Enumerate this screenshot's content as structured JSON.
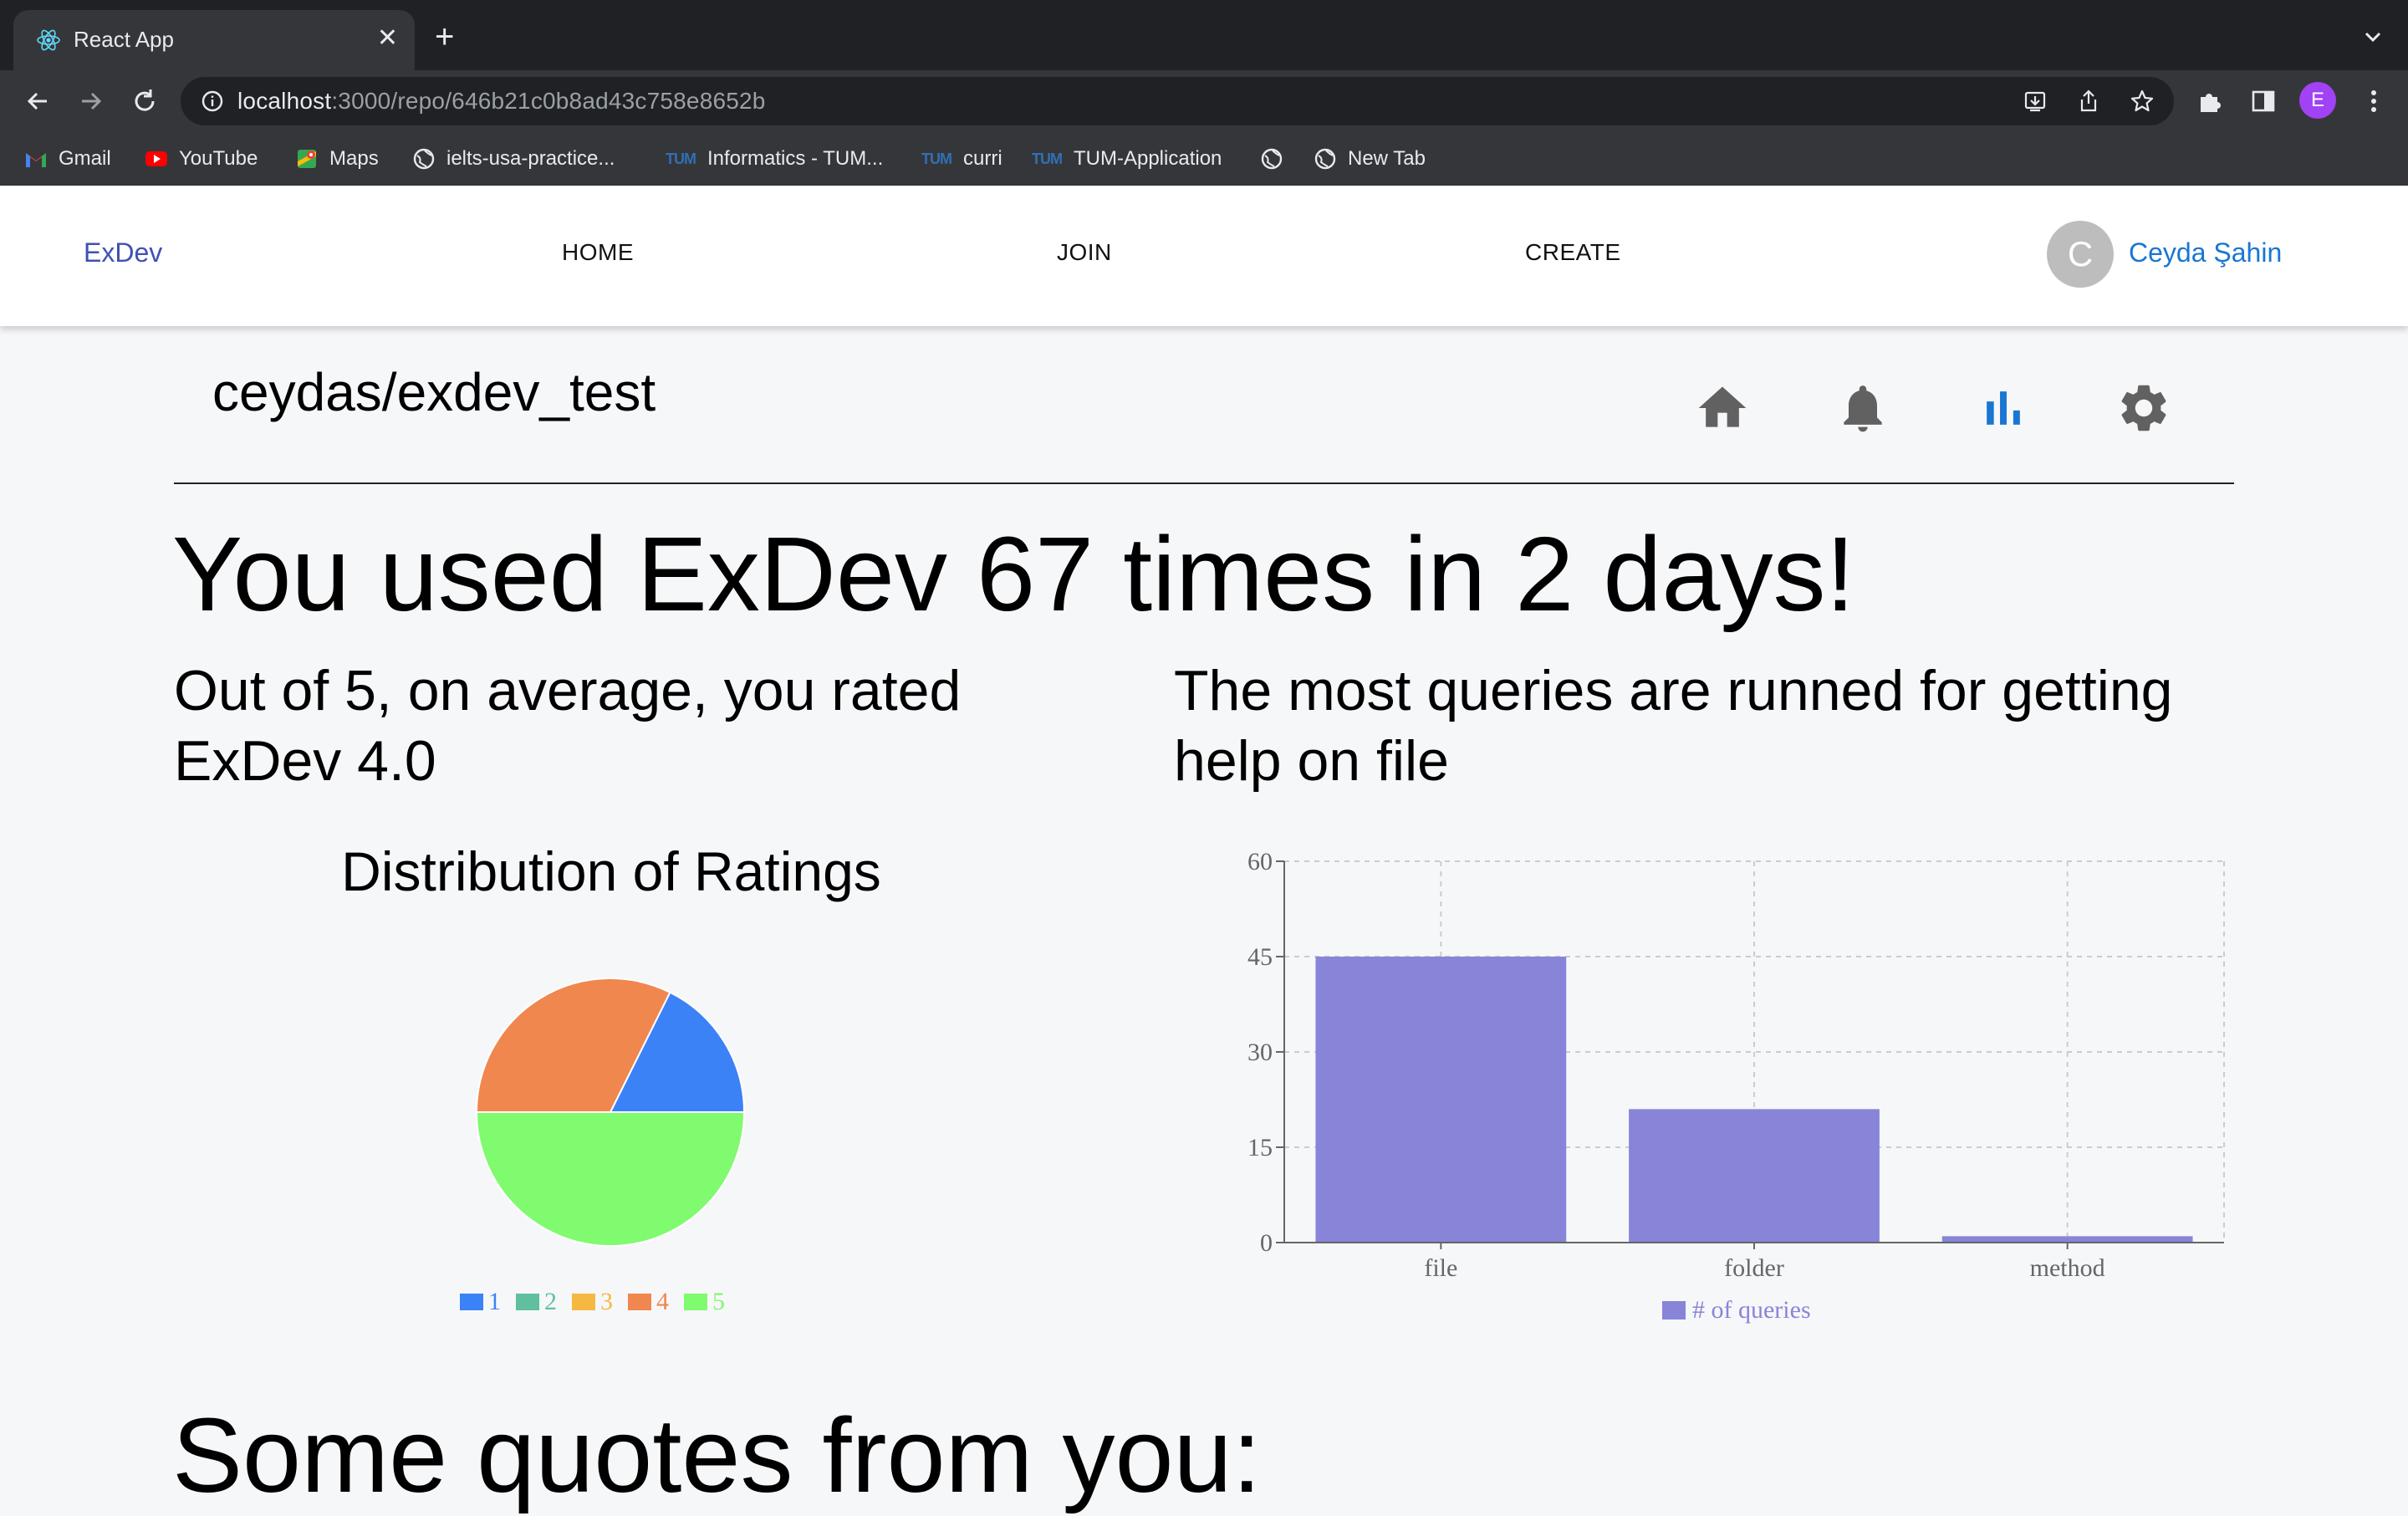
{
  "browser": {
    "tab_title": "React App",
    "url_host": "localhost",
    "url_path": ":3000/repo/646b21c0b8ad43c758e8652b",
    "profile_initial": "E",
    "bookmarks": [
      "Gmail",
      "YouTube",
      "Maps",
      "ielts-usa-practice...",
      "Informatics - TUM...",
      "curri",
      "TUM-Application",
      "New Tab"
    ]
  },
  "navbar": {
    "brand": "ExDev",
    "links": [
      "HOME",
      "JOIN",
      "CREATE"
    ],
    "avatar_initial": "C",
    "user_name": "Ceyda Şahin"
  },
  "repo": {
    "title": "ceydas/exdev_test",
    "icons": [
      "home-icon",
      "bell-icon",
      "bar-chart-icon",
      "gear-icon"
    ],
    "active_icon": "bar-chart-icon",
    "active_color": "#1976d2",
    "icon_color": "#616161"
  },
  "stats": {
    "headline": "You used ExDev 67 times in 2 days!",
    "rating_text": "Out of 5, on average, you rated ExDev 4.0",
    "queries_text": "The most queries are runned for getting help on file",
    "quotes_heading": "Some quotes from you:"
  },
  "chart_data": [
    {
      "type": "pie",
      "title": "Distribution of Ratings",
      "labels": [
        "1",
        "2",
        "3",
        "4",
        "5"
      ],
      "values": [
        6,
        0,
        0,
        11,
        17
      ],
      "colors": [
        "#3b82f6",
        "#5fbf9f",
        "#f5b942",
        "#f0874f",
        "#80fa6f"
      ],
      "legend": "bottom"
    },
    {
      "type": "bar",
      "categories": [
        "file",
        "folder",
        "method"
      ],
      "series": [
        {
          "name": "# of queries",
          "values": [
            45,
            21,
            1
          ],
          "color": "#8884d8"
        }
      ],
      "ylim": [
        0,
        60
      ],
      "yticks": [
        0,
        15,
        30,
        45,
        60
      ],
      "grid": true,
      "legend": "bottom"
    }
  ]
}
